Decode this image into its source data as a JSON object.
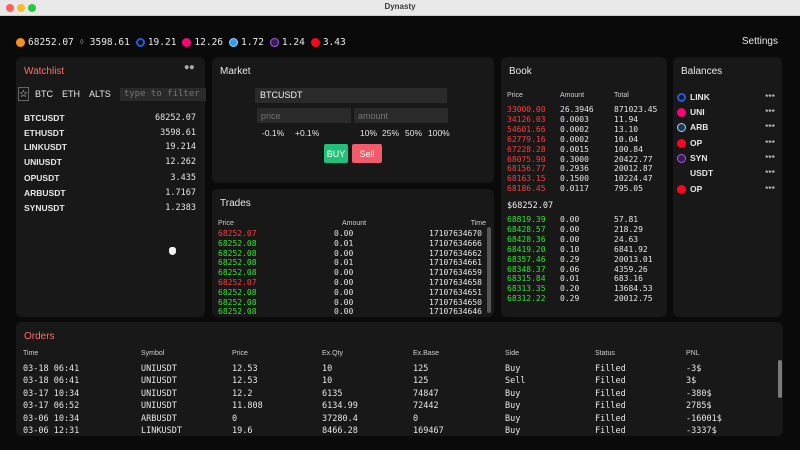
{
  "window": {
    "title": "Dynasty"
  },
  "ticker": [
    {
      "value": "68252.07",
      "icon": "btc-icon",
      "color": "#f7931a"
    },
    {
      "value": "3598.61",
      "icon": "eth-icon",
      "color": "#9a9a9a"
    },
    {
      "value": "19.21",
      "icon": "link-icon",
      "color": "#2a5ada"
    },
    {
      "value": "12.26",
      "icon": "uni-icon",
      "color": "#ff007a"
    },
    {
      "value": "1.72",
      "icon": "arb-icon",
      "color": "#28a0f0"
    },
    {
      "value": "1.24",
      "icon": "syn-icon",
      "color": "#a35ee8"
    },
    {
      "value": "3.43",
      "icon": "op-icon",
      "color": "#ff0420"
    }
  ],
  "settings_label": "Settings",
  "watchlist": {
    "title": "Watchlist",
    "tabs": [
      "BTC",
      "ETH",
      "ALTS"
    ],
    "filter_placeholder": "type to filter",
    "rows": [
      {
        "symbol": "BTCUSDT",
        "price": "68252.07"
      },
      {
        "symbol": "ETHUSDT",
        "price": "3598.61"
      },
      {
        "symbol": "LINKUSDT",
        "price": "19.214"
      },
      {
        "symbol": "UNIUSDT",
        "price": "12.262"
      },
      {
        "symbol": "OPUSDT",
        "price": "3.435"
      },
      {
        "symbol": "ARBUSDT",
        "price": "1.7167"
      },
      {
        "symbol": "SYNUSDT",
        "price": "1.2383"
      }
    ]
  },
  "market": {
    "title": "Market",
    "symbol": "BTCUSDT",
    "price_placeholder": "price",
    "amount_placeholder": "amount",
    "price_adjust": [
      "-0.1%",
      "+0.1%"
    ],
    "amount_pct": [
      "10%",
      "25%",
      "50%",
      "100%"
    ],
    "buy_label": "BUY",
    "sell_label": "Sell"
  },
  "trades": {
    "title": "Trades",
    "headers": {
      "price": "Price",
      "amount": "Amount",
      "time": "Time"
    },
    "rows": [
      {
        "price": "68252.07",
        "amount": "0.00",
        "time": "17107634670",
        "side": "sell"
      },
      {
        "price": "68252.08",
        "amount": "0.01",
        "time": "17107634666",
        "side": "buy"
      },
      {
        "price": "68252.08",
        "amount": "0.00",
        "time": "17107634662",
        "side": "buy"
      },
      {
        "price": "68252.08",
        "amount": "0.01",
        "time": "17107634661",
        "side": "buy"
      },
      {
        "price": "68252.08",
        "amount": "0.00",
        "time": "17107634659",
        "side": "buy"
      },
      {
        "price": "68252.07",
        "amount": "0.00",
        "time": "17107634658",
        "side": "sell"
      },
      {
        "price": "68252.08",
        "amount": "0.00",
        "time": "17107634651",
        "side": "buy"
      },
      {
        "price": "68252.08",
        "amount": "0.00",
        "time": "17107634650",
        "side": "buy"
      },
      {
        "price": "68252.08",
        "amount": "0.00",
        "time": "17107634646",
        "side": "buy"
      }
    ]
  },
  "book": {
    "title": "Book",
    "headers": {
      "price": "Price",
      "amount": "Amount",
      "total": "Total"
    },
    "asks": [
      {
        "price": "33000.00",
        "amount": "26.3946",
        "total": "871023.45"
      },
      {
        "price": "34126.03",
        "amount": "0.0003",
        "total": "11.94"
      },
      {
        "price": "54601.66",
        "amount": "0.0002",
        "total": "13.10"
      },
      {
        "price": "62779.16",
        "amount": "0.0002",
        "total": "10.04"
      },
      {
        "price": "67228.28",
        "amount": "0.0015",
        "total": "100.84"
      },
      {
        "price": "68075.90",
        "amount": "0.3000",
        "total": "20422.77"
      },
      {
        "price": "68156.77",
        "amount": "0.2936",
        "total": "20012.87"
      },
      {
        "price": "68163.15",
        "amount": "0.1500",
        "total": "10224.47"
      },
      {
        "price": "68186.45",
        "amount": "0.0117",
        "total": "795.05"
      }
    ],
    "mid_price": "$68252.07",
    "bids": [
      {
        "price": "68819.39",
        "amount": "0.00",
        "total": "57.81"
      },
      {
        "price": "68428.57",
        "amount": "0.00",
        "total": "218.29"
      },
      {
        "price": "68428.36",
        "amount": "0.00",
        "total": "24.63"
      },
      {
        "price": "68419.20",
        "amount": "0.10",
        "total": "6841.92"
      },
      {
        "price": "68357.46",
        "amount": "0.29",
        "total": "20013.01"
      },
      {
        "price": "68348.37",
        "amount": "0.06",
        "total": "4359.26"
      },
      {
        "price": "68315.84",
        "amount": "0.01",
        "total": "683.16"
      },
      {
        "price": "68313.35",
        "amount": "0.20",
        "total": "13684.53"
      },
      {
        "price": "68312.22",
        "amount": "0.29",
        "total": "20012.75"
      }
    ]
  },
  "balances": {
    "title": "Balances",
    "rows": [
      {
        "name": "LINK",
        "value": "***",
        "icon": "link-icon",
        "color": "#2a5ada"
      },
      {
        "name": "UNI",
        "value": "***",
        "icon": "uni-icon",
        "color": "#ff007a"
      },
      {
        "name": "ARB",
        "value": "***",
        "icon": "arb-icon",
        "color": "#28a0f0"
      },
      {
        "name": "OP",
        "value": "***",
        "icon": "op-icon",
        "color": "#ff0420"
      },
      {
        "name": "SYN",
        "value": "***",
        "icon": "syn-icon",
        "color": "#a35ee8"
      },
      {
        "name": "USDT",
        "value": "***",
        "icon": "",
        "color": ""
      },
      {
        "name": "OP",
        "value": "***",
        "icon": "op-icon",
        "color": "#ff0420"
      }
    ]
  },
  "orders": {
    "title": "Orders",
    "headers": [
      "Time",
      "Symbol",
      "Price",
      "Ex.Qty",
      "Ex.Base",
      "Side",
      "Status",
      "PNL"
    ],
    "rows": [
      [
        "03-18 06:41",
        "UNIUSDT",
        "12.53",
        "10",
        "125",
        "Buy",
        "Filled",
        "-3$"
      ],
      [
        "03-18 06:41",
        "UNIUSDT",
        "12.53",
        "10",
        "125",
        "Sell",
        "Filled",
        "3$"
      ],
      [
        "03-17 10:34",
        "UNIUSDT",
        "12.2",
        "6135",
        "74847",
        "Buy",
        "Filled",
        "-380$"
      ],
      [
        "03-17 06:52",
        "UNIUSDT",
        "11.808",
        "6134.99",
        "72442",
        "Buy",
        "Filled",
        "2785$"
      ],
      [
        "03-06 10:34",
        "ARBUSDT",
        "0",
        "37280.4",
        "0",
        "Buy",
        "Filled",
        "-16001$"
      ],
      [
        "03-06 12:31",
        "LINKUSDT",
        "19.6",
        "8466.28",
        "169467",
        "Buy",
        "Filled",
        "-3337$"
      ]
    ]
  },
  "colors": {
    "buy": "#2ee62e",
    "sell": "#ff3b3b",
    "buy_button": "#22c17a",
    "sell_button": "#f25c6a"
  }
}
